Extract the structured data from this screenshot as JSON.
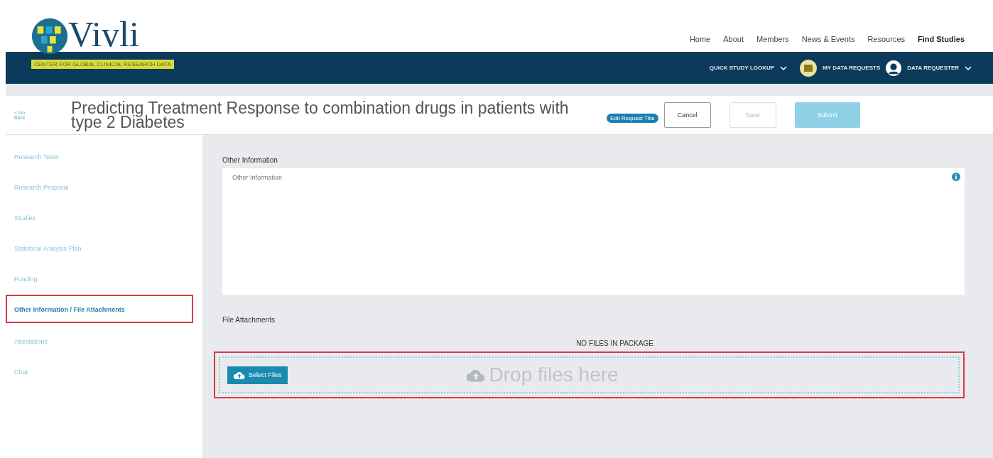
{
  "header": {
    "logo_text": "Vivli",
    "tagline": "CENTER FOR GLOBAL CLINICAL RESEARCH DATA",
    "nav": [
      {
        "label": "Home",
        "selected": false
      },
      {
        "label": "About",
        "selected": false
      },
      {
        "label": "Members",
        "selected": false
      },
      {
        "label": "News & Events",
        "selected": false
      },
      {
        "label": "Resources",
        "selected": false
      },
      {
        "label": "Find Studies",
        "selected": true
      }
    ],
    "quick_lookup": "QUICK STUDY LOOKUP",
    "my_requests": "MY DATA REQUESTS",
    "user": "DATA REQUESTER"
  },
  "request": {
    "back": "< Go Back",
    "title": "Predicting Treatment Response to combination drugs in patients with type 2 Diabetes",
    "edit_title": "Edit Request Title",
    "buttons": [
      {
        "label": "Cancel",
        "kind": "outline",
        "disabled": false
      },
      {
        "label": "Save",
        "kind": "outline",
        "disabled": true
      },
      {
        "label": "Submit",
        "kind": "primary",
        "disabled": true
      }
    ]
  },
  "sidebar": {
    "items": [
      {
        "label": "Research Team",
        "selected": false,
        "highlighted": false
      },
      {
        "label": "Research Proposal",
        "selected": false,
        "highlighted": false
      },
      {
        "label": "Studies",
        "selected": false,
        "highlighted": false
      },
      {
        "label": "Statistical Analysis Plan",
        "selected": false,
        "highlighted": false
      },
      {
        "label": "Funding",
        "selected": false,
        "highlighted": false
      },
      {
        "label": "Other Information / File Attachments",
        "selected": true,
        "highlighted": true
      },
      {
        "label": "Attestations",
        "selected": false,
        "highlighted": false
      },
      {
        "label": "Chat",
        "selected": false,
        "highlighted": false
      }
    ]
  },
  "content": {
    "other_info_label": "Other Information",
    "other_info_placeholder": "Other Information",
    "attachments_label": "File Attachments",
    "empty_message": "NO FILES IN PACKAGE",
    "dropzone": {
      "button": "Select Files",
      "hint": "Drop files here",
      "highlighted": true
    }
  }
}
